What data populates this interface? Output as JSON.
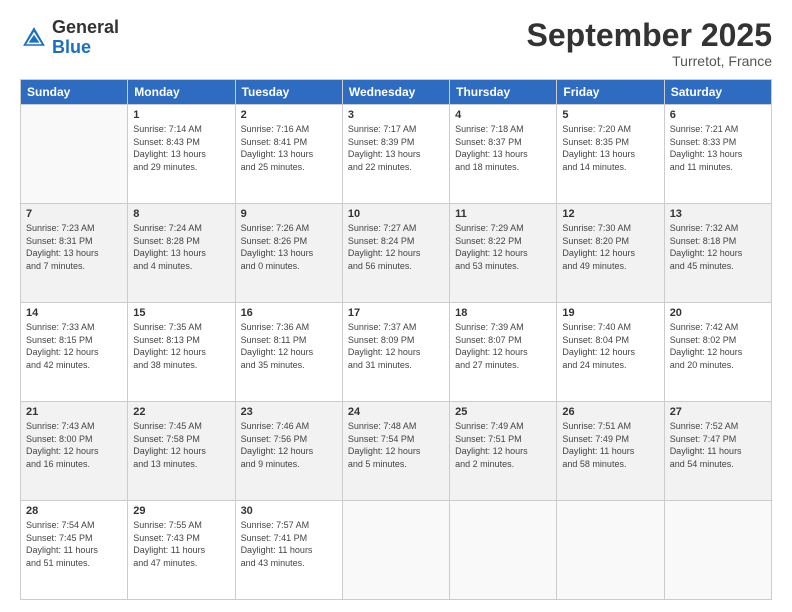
{
  "header": {
    "logo_general": "General",
    "logo_blue": "Blue",
    "month_title": "September 2025",
    "subtitle": "Turretot, France"
  },
  "days_of_week": [
    "Sunday",
    "Monday",
    "Tuesday",
    "Wednesday",
    "Thursday",
    "Friday",
    "Saturday"
  ],
  "weeks": [
    [
      {
        "num": "",
        "info": ""
      },
      {
        "num": "1",
        "info": "Sunrise: 7:14 AM\nSunset: 8:43 PM\nDaylight: 13 hours\nand 29 minutes."
      },
      {
        "num": "2",
        "info": "Sunrise: 7:16 AM\nSunset: 8:41 PM\nDaylight: 13 hours\nand 25 minutes."
      },
      {
        "num": "3",
        "info": "Sunrise: 7:17 AM\nSunset: 8:39 PM\nDaylight: 13 hours\nand 22 minutes."
      },
      {
        "num": "4",
        "info": "Sunrise: 7:18 AM\nSunset: 8:37 PM\nDaylight: 13 hours\nand 18 minutes."
      },
      {
        "num": "5",
        "info": "Sunrise: 7:20 AM\nSunset: 8:35 PM\nDaylight: 13 hours\nand 14 minutes."
      },
      {
        "num": "6",
        "info": "Sunrise: 7:21 AM\nSunset: 8:33 PM\nDaylight: 13 hours\nand 11 minutes."
      }
    ],
    [
      {
        "num": "7",
        "info": "Sunrise: 7:23 AM\nSunset: 8:31 PM\nDaylight: 13 hours\nand 7 minutes."
      },
      {
        "num": "8",
        "info": "Sunrise: 7:24 AM\nSunset: 8:28 PM\nDaylight: 13 hours\nand 4 minutes."
      },
      {
        "num": "9",
        "info": "Sunrise: 7:26 AM\nSunset: 8:26 PM\nDaylight: 13 hours\nand 0 minutes."
      },
      {
        "num": "10",
        "info": "Sunrise: 7:27 AM\nSunset: 8:24 PM\nDaylight: 12 hours\nand 56 minutes."
      },
      {
        "num": "11",
        "info": "Sunrise: 7:29 AM\nSunset: 8:22 PM\nDaylight: 12 hours\nand 53 minutes."
      },
      {
        "num": "12",
        "info": "Sunrise: 7:30 AM\nSunset: 8:20 PM\nDaylight: 12 hours\nand 49 minutes."
      },
      {
        "num": "13",
        "info": "Sunrise: 7:32 AM\nSunset: 8:18 PM\nDaylight: 12 hours\nand 45 minutes."
      }
    ],
    [
      {
        "num": "14",
        "info": "Sunrise: 7:33 AM\nSunset: 8:15 PM\nDaylight: 12 hours\nand 42 minutes."
      },
      {
        "num": "15",
        "info": "Sunrise: 7:35 AM\nSunset: 8:13 PM\nDaylight: 12 hours\nand 38 minutes."
      },
      {
        "num": "16",
        "info": "Sunrise: 7:36 AM\nSunset: 8:11 PM\nDaylight: 12 hours\nand 35 minutes."
      },
      {
        "num": "17",
        "info": "Sunrise: 7:37 AM\nSunset: 8:09 PM\nDaylight: 12 hours\nand 31 minutes."
      },
      {
        "num": "18",
        "info": "Sunrise: 7:39 AM\nSunset: 8:07 PM\nDaylight: 12 hours\nand 27 minutes."
      },
      {
        "num": "19",
        "info": "Sunrise: 7:40 AM\nSunset: 8:04 PM\nDaylight: 12 hours\nand 24 minutes."
      },
      {
        "num": "20",
        "info": "Sunrise: 7:42 AM\nSunset: 8:02 PM\nDaylight: 12 hours\nand 20 minutes."
      }
    ],
    [
      {
        "num": "21",
        "info": "Sunrise: 7:43 AM\nSunset: 8:00 PM\nDaylight: 12 hours\nand 16 minutes."
      },
      {
        "num": "22",
        "info": "Sunrise: 7:45 AM\nSunset: 7:58 PM\nDaylight: 12 hours\nand 13 minutes."
      },
      {
        "num": "23",
        "info": "Sunrise: 7:46 AM\nSunset: 7:56 PM\nDaylight: 12 hours\nand 9 minutes."
      },
      {
        "num": "24",
        "info": "Sunrise: 7:48 AM\nSunset: 7:54 PM\nDaylight: 12 hours\nand 5 minutes."
      },
      {
        "num": "25",
        "info": "Sunrise: 7:49 AM\nSunset: 7:51 PM\nDaylight: 12 hours\nand 2 minutes."
      },
      {
        "num": "26",
        "info": "Sunrise: 7:51 AM\nSunset: 7:49 PM\nDaylight: 11 hours\nand 58 minutes."
      },
      {
        "num": "27",
        "info": "Sunrise: 7:52 AM\nSunset: 7:47 PM\nDaylight: 11 hours\nand 54 minutes."
      }
    ],
    [
      {
        "num": "28",
        "info": "Sunrise: 7:54 AM\nSunset: 7:45 PM\nDaylight: 11 hours\nand 51 minutes."
      },
      {
        "num": "29",
        "info": "Sunrise: 7:55 AM\nSunset: 7:43 PM\nDaylight: 11 hours\nand 47 minutes."
      },
      {
        "num": "30",
        "info": "Sunrise: 7:57 AM\nSunset: 7:41 PM\nDaylight: 11 hours\nand 43 minutes."
      },
      {
        "num": "",
        "info": ""
      },
      {
        "num": "",
        "info": ""
      },
      {
        "num": "",
        "info": ""
      },
      {
        "num": "",
        "info": ""
      }
    ]
  ]
}
